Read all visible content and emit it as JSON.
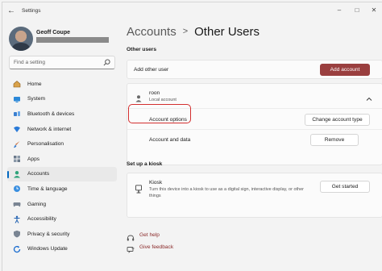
{
  "window": {
    "title": "Settings"
  },
  "user": {
    "name": "Geoff Coupe"
  },
  "search": {
    "placeholder": "Find a setting"
  },
  "nav": [
    {
      "label": "Home",
      "icon": "home-icon"
    },
    {
      "label": "System",
      "icon": "system-icon"
    },
    {
      "label": "Bluetooth & devices",
      "icon": "bluetooth-icon"
    },
    {
      "label": "Network & internet",
      "icon": "network-icon"
    },
    {
      "label": "Personalisation",
      "icon": "brush-icon"
    },
    {
      "label": "Apps",
      "icon": "apps-icon"
    },
    {
      "label": "Accounts",
      "icon": "accounts-icon",
      "active": true
    },
    {
      "label": "Time & language",
      "icon": "globe-clock-icon"
    },
    {
      "label": "Gaming",
      "icon": "gaming-icon"
    },
    {
      "label": "Accessibility",
      "icon": "accessibility-icon"
    },
    {
      "label": "Privacy & security",
      "icon": "shield-icon"
    },
    {
      "label": "Windows Update",
      "icon": "update-icon"
    }
  ],
  "breadcrumb": {
    "parent": "Accounts",
    "separator": ">",
    "current": "Other Users"
  },
  "other_users": {
    "section_title": "Other users",
    "add_label": "Add other user",
    "add_button": "Add account",
    "account": {
      "name": "roon",
      "type": "Local account"
    },
    "options_label": "Account options",
    "options_button": "Change account type",
    "data_label": "Account and data",
    "remove_button": "Remove"
  },
  "kiosk": {
    "section_title": "Set up a kiosk",
    "title": "Kiosk",
    "description": "Turn this device into a kiosk to use as a digital sign, interactive display, or other things",
    "button": "Get started"
  },
  "links": {
    "help": "Get help",
    "feedback": "Give feedback"
  },
  "colors": {
    "accent": "#9a3f3f",
    "highlight": "#d32f2f",
    "link": "#8b2b2b",
    "nav_indicator": "#0067c0"
  }
}
